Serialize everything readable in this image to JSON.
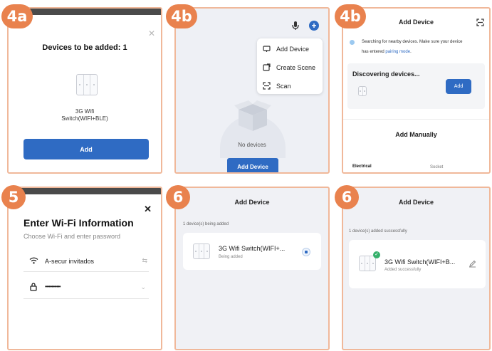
{
  "badges": {
    "p1": "4a",
    "p2": "4b",
    "p3": "4b",
    "p4": "5",
    "p5": "6",
    "p6": "6"
  },
  "panel_4a": {
    "title": "Devices to be added: 1",
    "device_name_line1": "3G Wifi",
    "device_name_line2": "Switch(WIFI+BLE)",
    "add_button": "Add"
  },
  "panel_4b_menu": {
    "menu_items": [
      "Add Device",
      "Create Scene",
      "Scan"
    ],
    "empty_text": "No devices",
    "add_device_button": "Add Device"
  },
  "panel_4b_search": {
    "title": "Add Device",
    "searching_text_1": "Searching for nearby devices. Make sure your device",
    "searching_text_2": "has entered",
    "pairing_link": "pairing mode",
    "period": ".",
    "discovering_label": "Discovering devices...",
    "add_button": "Add",
    "add_manually": "Add Manually",
    "category_electrical": "Electrical",
    "category_socket": "Socket"
  },
  "panel_5": {
    "title": "Enter Wi-Fi Information",
    "subtitle": "Choose Wi-Fi and enter password",
    "wifi_name": "A-secur invitados",
    "password_masked": "••••••••••••"
  },
  "panel_6a": {
    "title": "Add Device",
    "status_line": "1 device(s) being added",
    "device_name": "3G Wifi Switch(WIFI+...",
    "device_status": "Being added"
  },
  "panel_6b": {
    "title": "Add Device",
    "status_line": "1 device(s) added successfully",
    "device_name": "3G Wifi Switch(WIFI+B...",
    "device_status": "Added successfully"
  },
  "colors": {
    "accent": "#2f6bc3",
    "badge": "#e9824e",
    "border": "#f0b89a",
    "success": "#35b06b"
  }
}
